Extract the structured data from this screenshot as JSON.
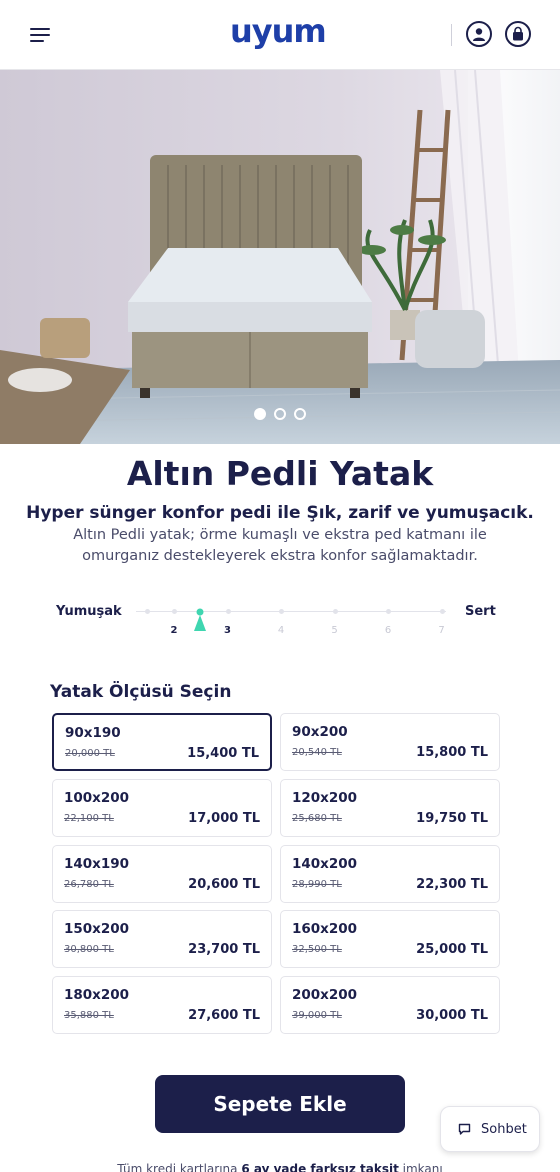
{
  "header": {
    "logo": "uyum",
    "menu_icon": "hamburger-menu-icon",
    "account_icon": "user-icon",
    "cart_icon": "shopping-bag-icon"
  },
  "hero": {
    "slides": 3,
    "active_slide": 1
  },
  "product": {
    "title": "Altın Pedli Yatak",
    "subtitle": "Hyper sünger konfor pedi ile Şık, zarif ve yumuşacık.",
    "description": "Altın Pedli yatak; örme kumaşlı ve ekstra ped katmanı ile omurganız destekleyerek ekstra konfor sağlamaktadır."
  },
  "firmness": {
    "left_label": "Yumuşak",
    "right_label": "Sert",
    "scale": [
      "2",
      "3",
      "4",
      "5",
      "6",
      "7"
    ],
    "selected_value": 2.5,
    "marker_color": "#3fd6b0"
  },
  "sizes": {
    "heading": "Yatak Ölçüsü Seçin",
    "items": [
      {
        "name": "90x190",
        "old_price": "20,000 TL",
        "price": "15,400 TL",
        "selected": true
      },
      {
        "name": "90x200",
        "old_price": "20,540 TL",
        "price": "15,800 TL",
        "selected": false
      },
      {
        "name": "100x200",
        "old_price": "22,100 TL",
        "price": "17,000 TL",
        "selected": false
      },
      {
        "name": "120x200",
        "old_price": "25,680 TL",
        "price": "19,750 TL",
        "selected": false
      },
      {
        "name": "140x190",
        "old_price": "26,780 TL",
        "price": "20,600 TL",
        "selected": false
      },
      {
        "name": "140x200",
        "old_price": "28,990 TL",
        "price": "22,300 TL",
        "selected": false
      },
      {
        "name": "150x200",
        "old_price": "30,800 TL",
        "price": "23,700 TL",
        "selected": false
      },
      {
        "name": "160x200",
        "old_price": "32,500 TL",
        "price": "25,000 TL",
        "selected": false
      },
      {
        "name": "180x200",
        "old_price": "35,880 TL",
        "price": "27,600 TL",
        "selected": false
      },
      {
        "name": "200x200",
        "old_price": "39,000 TL",
        "price": "30,000 TL",
        "selected": false
      }
    ]
  },
  "cta": {
    "add_to_cart": "Sepete Ekle"
  },
  "chat": {
    "label": "Sohbet",
    "icon": "chat-bubble-icon"
  },
  "footer": {
    "note_prefix": "Tüm kredi kartlarına ",
    "note_bold": "6 ay vade farksız taksit",
    "note_suffix": " imkanı"
  },
  "colors": {
    "brand_navy": "#1c1f4a",
    "logo_blue": "#1e3fa8",
    "accent_teal": "#3fd6b0"
  }
}
